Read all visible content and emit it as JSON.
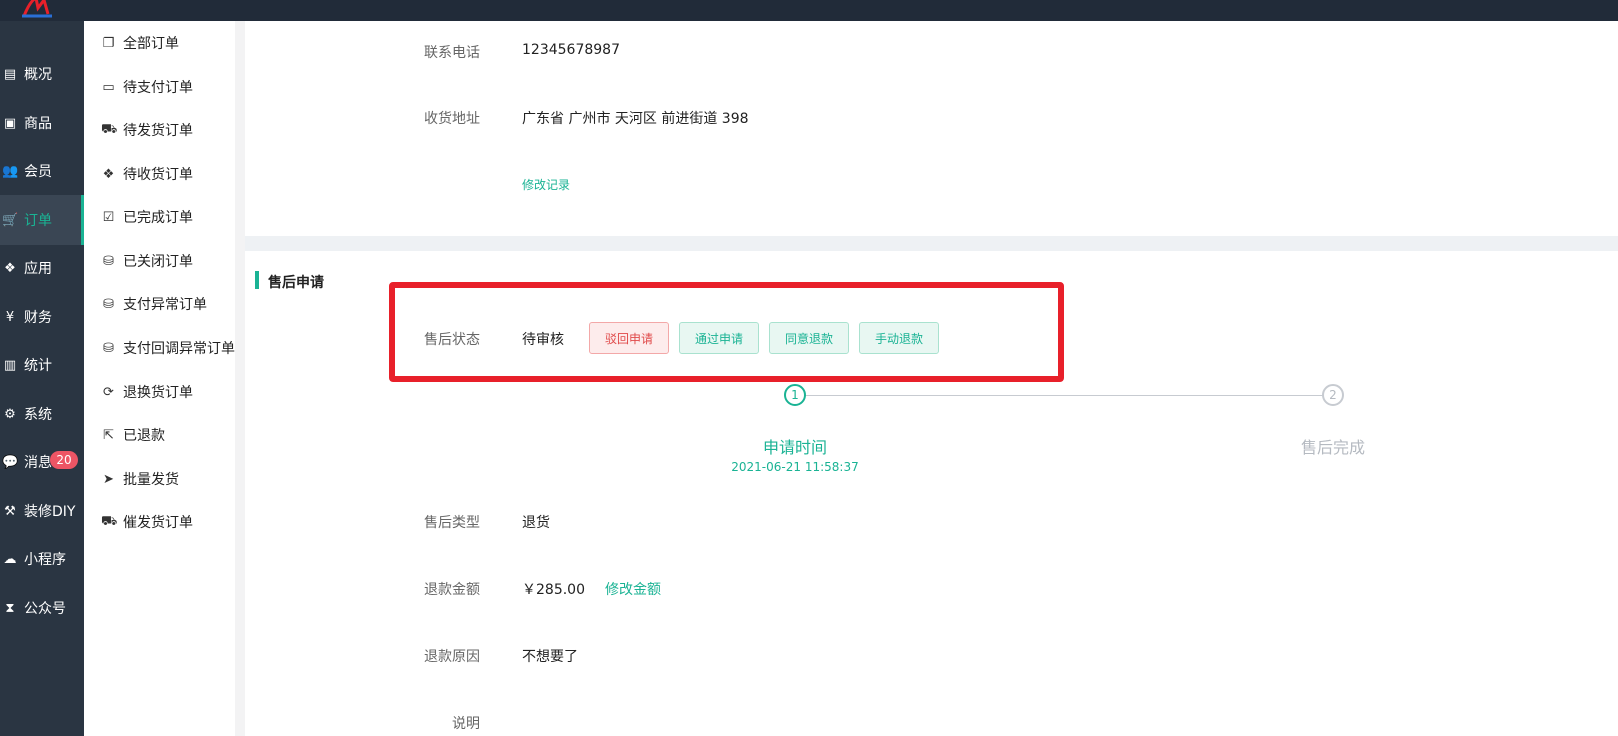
{
  "colors": {
    "accent": "#1ab394",
    "danger": "#e04a4a",
    "sidebar_bg": "#2a3542",
    "topbar_bg": "#212b39",
    "highlight_border": "#e8202a"
  },
  "primary_nav": [
    {
      "label": "概况",
      "icon": "archive-icon",
      "glyph": "▤"
    },
    {
      "label": "商品",
      "icon": "box-icon",
      "glyph": "▣"
    },
    {
      "label": "会员",
      "icon": "users-icon",
      "glyph": "👥"
    },
    {
      "label": "订单",
      "icon": "cart-icon",
      "glyph": "🛒"
    },
    {
      "label": "应用",
      "icon": "cubes-icon",
      "glyph": "❖"
    },
    {
      "label": "财务",
      "icon": "yen-icon",
      "glyph": "¥"
    },
    {
      "label": "统计",
      "icon": "bar-chart-icon",
      "glyph": "▥"
    },
    {
      "label": "系统",
      "icon": "gears-icon",
      "glyph": "⚙"
    },
    {
      "label": "消息",
      "icon": "comment-icon",
      "glyph": "💬"
    },
    {
      "label": "装修DIY",
      "icon": "gavel-icon",
      "glyph": "⚒"
    },
    {
      "label": "小程序",
      "icon": "wechat-icon",
      "glyph": "☁"
    },
    {
      "label": "公众号",
      "icon": "hourglass-icon",
      "glyph": "⧗"
    }
  ],
  "message_badge": "20",
  "secondary_nav": [
    {
      "label": "全部订单",
      "icon": "copy-icon",
      "glyph": "❐"
    },
    {
      "label": "待支付订单",
      "icon": "credit-card-icon",
      "glyph": "▭"
    },
    {
      "label": "待发货订单",
      "icon": "truck-icon",
      "glyph": "⛟"
    },
    {
      "label": "待收货订单",
      "icon": "dropbox-icon",
      "glyph": "❖"
    },
    {
      "label": "已完成订单",
      "icon": "check-square-icon",
      "glyph": "☑"
    },
    {
      "label": "已关闭订单",
      "icon": "coin-icon",
      "glyph": "⛁"
    },
    {
      "label": "支付异常订单",
      "icon": "coin-icon",
      "glyph": "⛁"
    },
    {
      "label": "支付回调异常订单",
      "icon": "coin-icon",
      "glyph": "⛁"
    },
    {
      "label": "退换货订单",
      "icon": "refresh-icon",
      "glyph": "⟳"
    },
    {
      "label": "已退款",
      "icon": "share-square-icon",
      "glyph": "⇱"
    },
    {
      "label": "批量发货",
      "icon": "paper-plane-icon",
      "glyph": "➤"
    },
    {
      "label": "催发货订单",
      "icon": "truck-icon",
      "glyph": "⛟"
    }
  ],
  "address_card": {
    "phone_label": "联系电话",
    "phone_value": "12345678987",
    "address_label": "收货地址",
    "address_value": "广东省 广州市 天河区 前进街道 398",
    "history_link": "修改记录"
  },
  "after_sale": {
    "section_title": "售后申请",
    "status_label": "售后状态",
    "status_value": "待审核",
    "actions": {
      "reject": "驳回申请",
      "approve": "通过申请",
      "agree_refund": "同意退款",
      "manual_refund": "手动退款"
    },
    "steps": [
      {
        "number": "1",
        "title": "申请时间",
        "time": "2021-06-21 11:58:37"
      },
      {
        "number": "2",
        "title": "售后完成"
      }
    ],
    "type_label": "售后类型",
    "type_value": "退货",
    "amount_label": "退款金额",
    "amount_value": "￥285.00",
    "amount_edit_link": "修改金额",
    "reason_label": "退款原因",
    "reason_value": "不想要了",
    "note_label": "说明"
  }
}
